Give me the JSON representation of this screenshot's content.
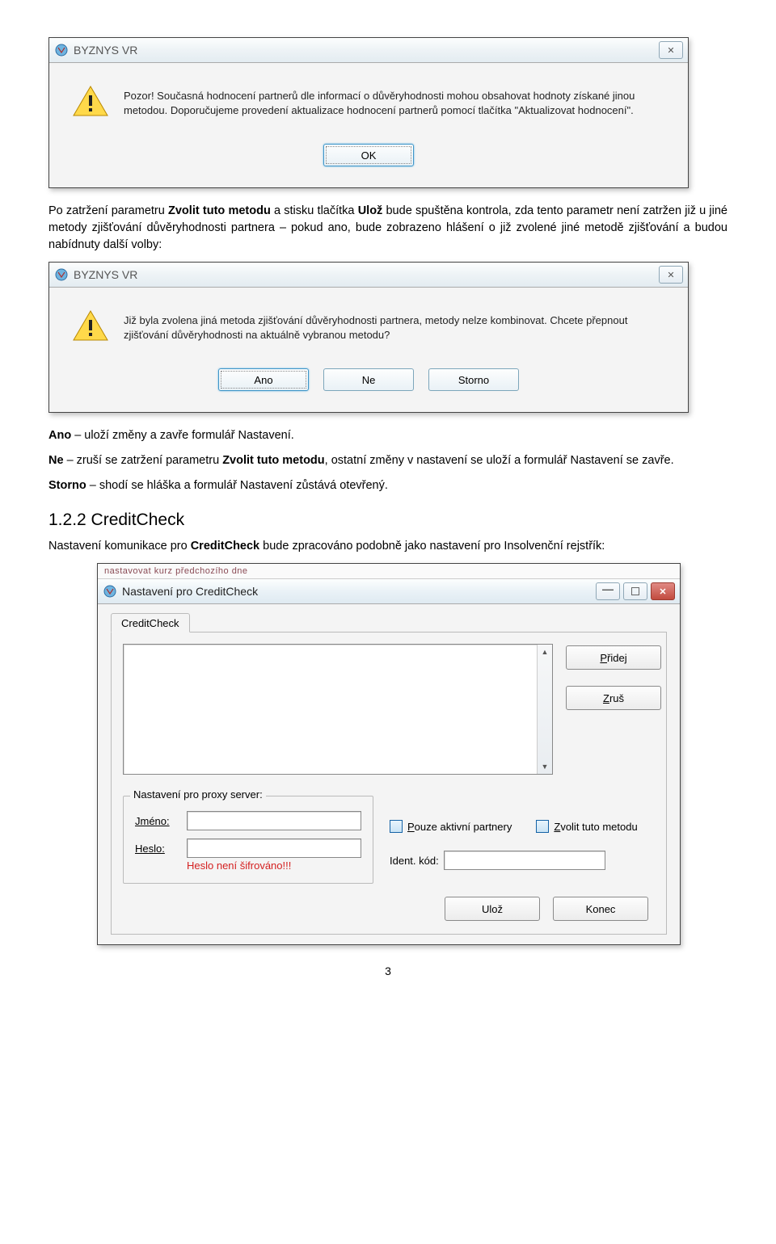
{
  "dialog1": {
    "title": "BYZNYS VR",
    "message": "Pozor! Současná hodnocení partnerů dle informací o důvěryhodnosti mohou obsahovat hodnoty získané jinou metodou. Doporučujeme provedení aktualizace hodnocení partnerů pomocí tlačítka \"Aktualizovat hodnocení\".",
    "ok": "OK"
  },
  "para1_a": "Po zatržení parametru ",
  "para1_b": "Zvolit tuto metodu",
  "para1_c": " a stisku tlačítka ",
  "para1_d": "Ulož",
  "para1_e": " bude spuštěna kontrola, zda tento parametr není zatržen již u jiné metody zjišťování důvěryhodnosti partnera – pokud ano, bude zobrazeno hlášení o již zvolené jiné metodě zjišťování a budou nabídnuty další volby:",
  "dialog2": {
    "title": "BYZNYS VR",
    "message": "Již byla zvolena jiná metoda zjišťování důvěryhodnosti partnera, metody nelze kombinovat. Chcete přepnout zjišťování důvěryhodnosti na aktuálně vybranou metodu?",
    "ano": "Ano",
    "ne": "Ne",
    "storno": "Storno"
  },
  "opt_ano_b": "Ano",
  "opt_ano_t": " – uloží změny a zavře formulář Nastavení.",
  "opt_ne_b": "Ne",
  "opt_ne_t1": " – zruší se zatržení parametru ",
  "opt_ne_t2": "Zvolit tuto metodu",
  "opt_ne_t3": ", ostatní změny v nastavení se uloží a formulář Nastavení se zavře.",
  "opt_st_b": "Storno",
  "opt_st_t": " – shodí se hláška a formulář Nastavení zůstává otevřený.",
  "section_heading": "1.2.2 CreditCheck",
  "para2_a": "Nastavení komunikace pro ",
  "para2_b": "CreditCheck",
  "para2_c": " bude zpracováno podobně jako nastavení pro Insolvenční rejstřík:",
  "settings": {
    "top_stripe": "nastavovat kurz předchozího dne",
    "title": "Nastavení pro CreditCheck",
    "tab": "CreditCheck",
    "add": "Přidej",
    "cancel": "Zruš",
    "proxy_legend": "Nastavení pro proxy server:",
    "jmeno": "Jméno:",
    "heslo": "Heslo:",
    "warn": "Heslo není šifrováno!!!",
    "chk1": "Pouze aktivní partnery",
    "chk2": "Zvolit tuto metodu",
    "ident": "Ident. kód:",
    "save": "Ulož",
    "close": "Konec"
  },
  "page_number": "3"
}
